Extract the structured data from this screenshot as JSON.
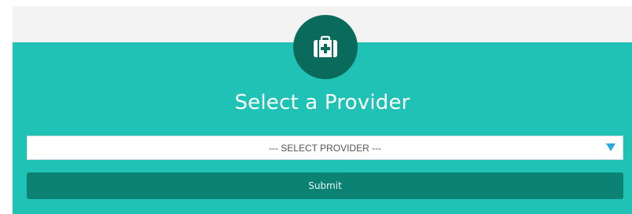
{
  "header": {
    "icon": "medical-kit-icon",
    "title": "Select a Provider"
  },
  "provider_select": {
    "selected": "--- SELECT PROVIDER ---",
    "options": [
      "--- SELECT PROVIDER ---"
    ]
  },
  "submit": {
    "label": "Submit"
  },
  "colors": {
    "panel": "#1fc2b5",
    "badge": "#0a6b5c",
    "button": "#0b8273",
    "arrow": "#2aa9e0"
  }
}
